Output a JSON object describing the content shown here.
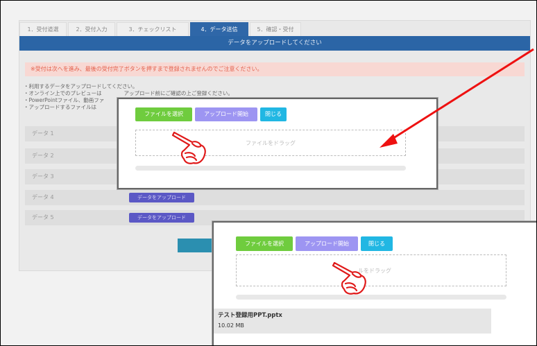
{
  "tabs": [
    "1．受付道選",
    "2．受付入力",
    "3．チェックリスト",
    "4．データ送信",
    "5．確認・受付"
  ],
  "header": {
    "title": "データをアップロードしてください"
  },
  "warning": "※受付は次へを進み、最後の受付完了ボタンを押すまで登録されませんのでご注意ください。",
  "notes": [
    "・利用するデータをアップロードしてください。",
    "・オンライン上でのプレビューは",
    "・PowerPointファイル、動画ファ",
    "・アップロードするファイルは"
  ],
  "notes_tail": "アップロード前にご確認の上ご登録ください。",
  "data_rows": [
    {
      "label": "データ 1",
      "button": ""
    },
    {
      "label": "データ 2",
      "button": ""
    },
    {
      "label": "データ 3",
      "button": ""
    },
    {
      "label": "データ 4",
      "button": "データをアップロード"
    },
    {
      "label": "データ 5",
      "button": "データをアップロード"
    }
  ],
  "dialog_top": {
    "select_label": "ファイルを選択",
    "start_label": "アップロード開始",
    "close_label": "閉じる",
    "drop_label": "ファイルをドラッグ"
  },
  "dialog_bottom": {
    "select_label": "ファイルを選択",
    "start_label": "アップロード開始",
    "close_label": "閉じる",
    "drop_label": "ルをドラッグ",
    "file_name": "テスト登録用PPT.pptx",
    "file_size": "10.02 MB"
  },
  "colors": {
    "arrow": "#ee1111",
    "header": "#2b65a6",
    "green": "#6fcc3e",
    "purple": "#9d95f2",
    "cyan": "#21b7e3"
  }
}
